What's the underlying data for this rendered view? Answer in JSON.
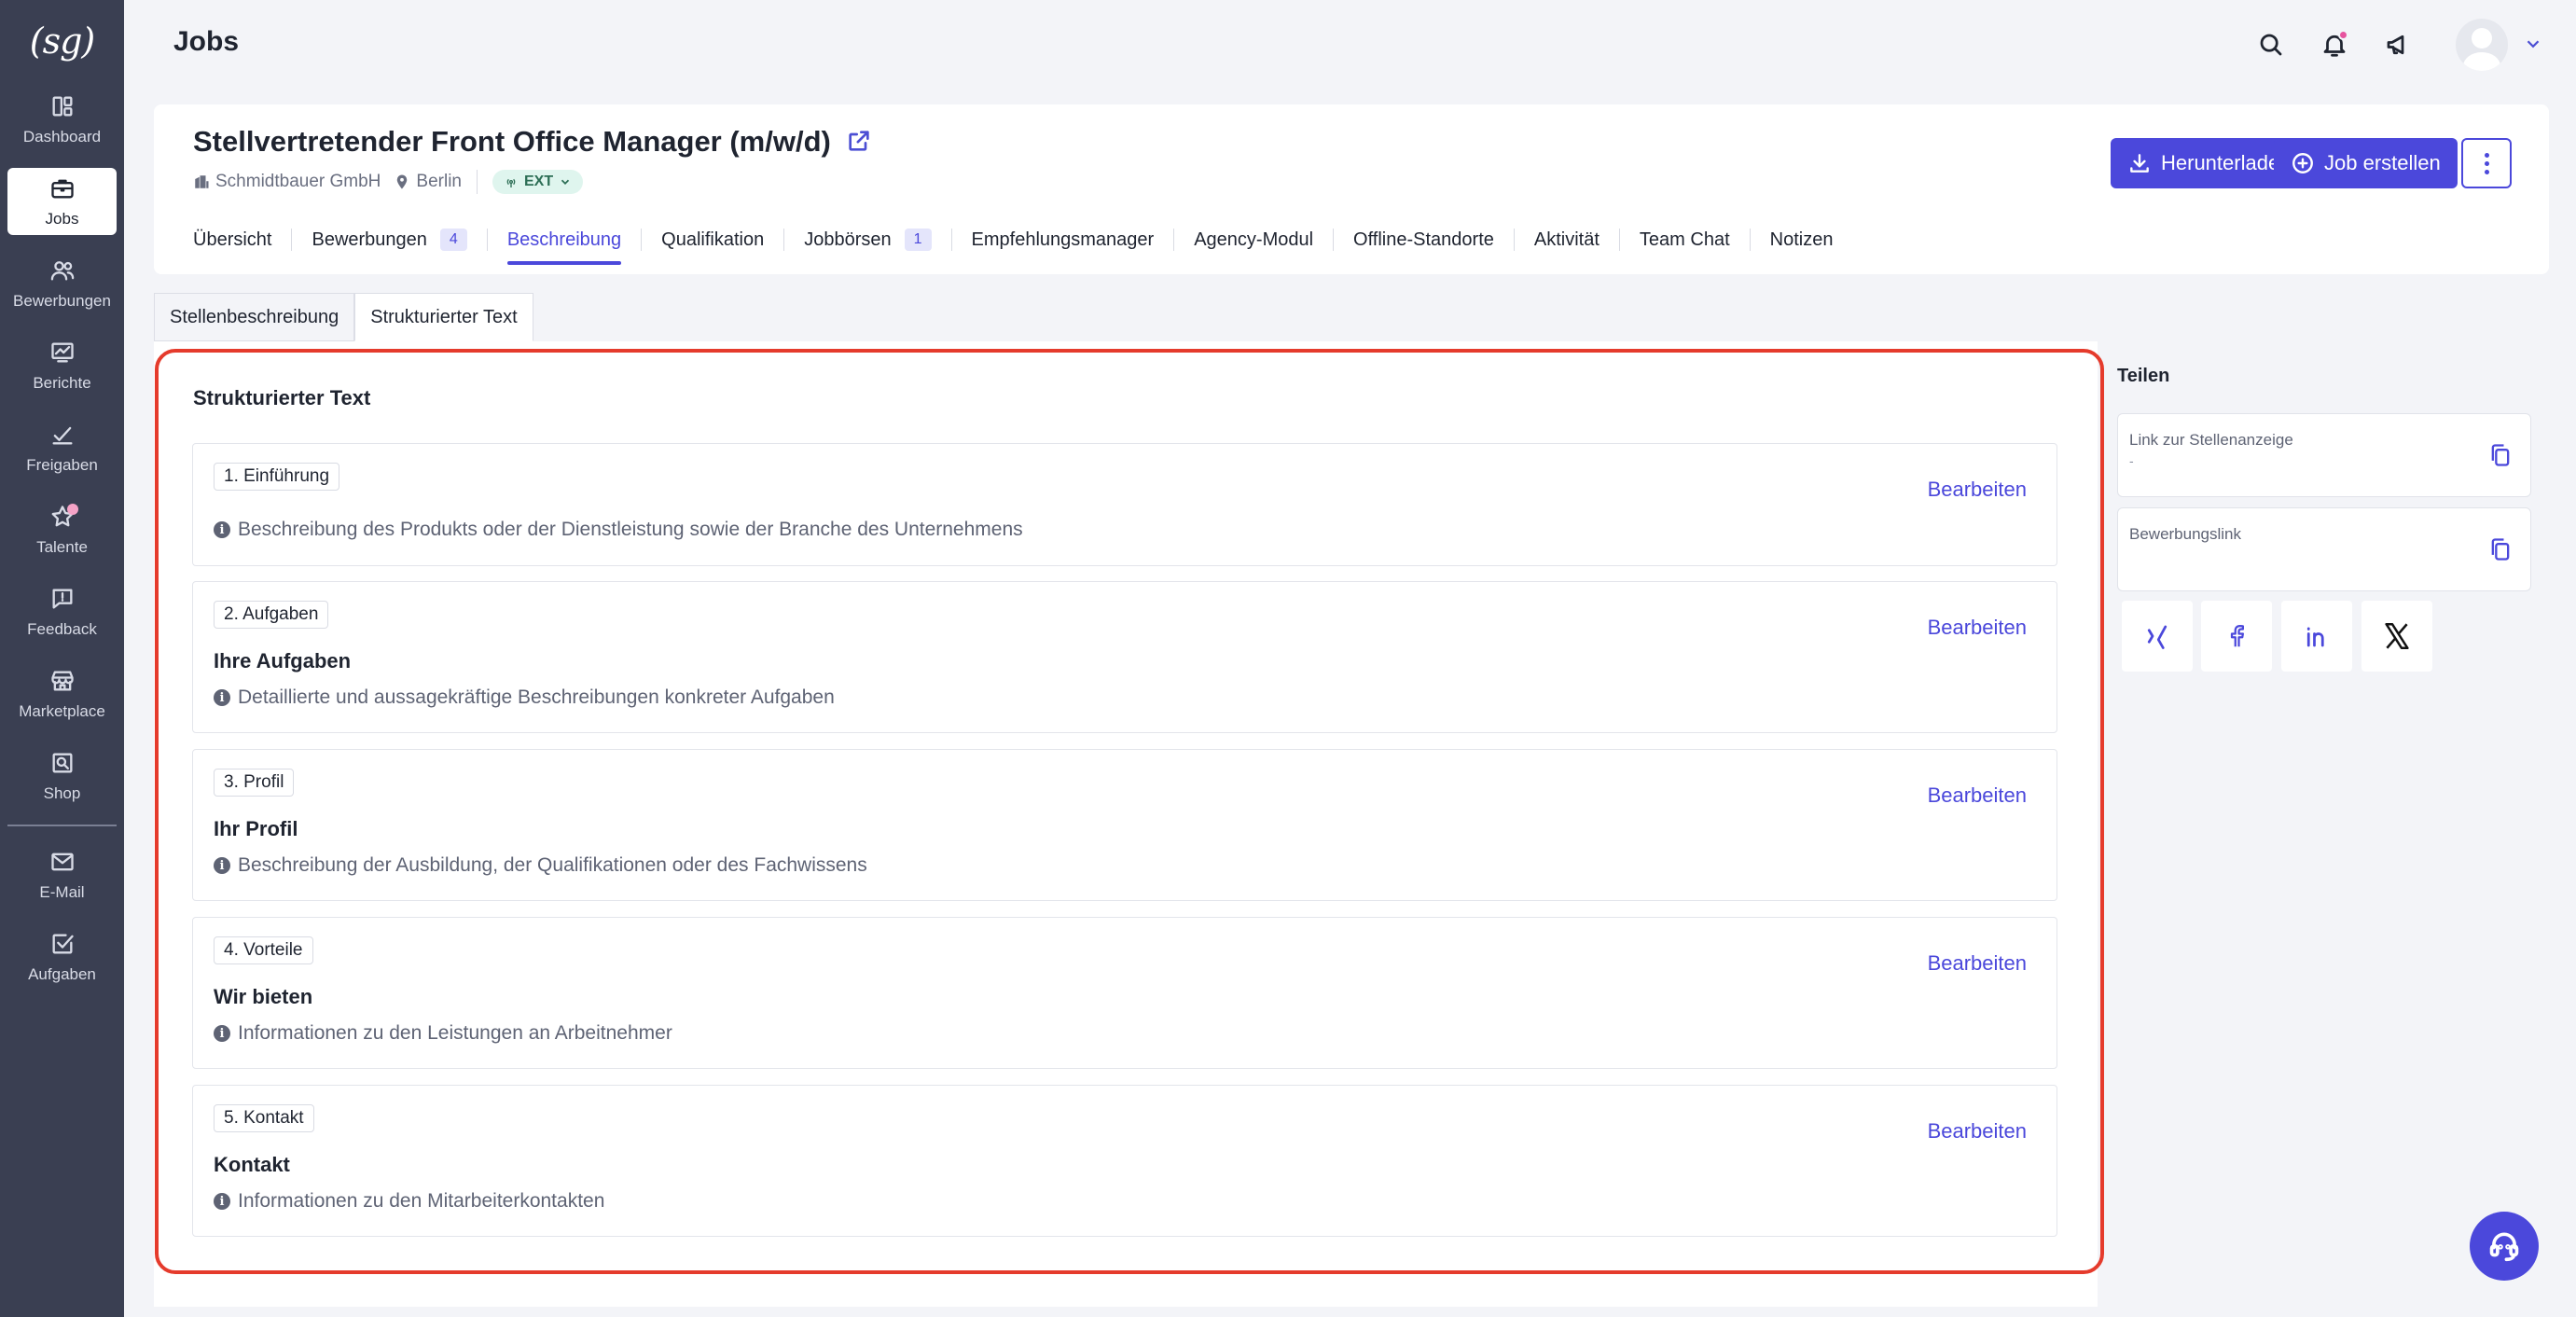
{
  "app": {
    "logo_text": "(sg)",
    "page_title": "Jobs"
  },
  "sidebar": {
    "items": [
      {
        "label": "Dashboard",
        "icon": "dashboard-icon"
      },
      {
        "label": "Jobs",
        "icon": "briefcase-icon",
        "active": true
      },
      {
        "label": "Bewerbungen",
        "icon": "users-icon"
      },
      {
        "label": "Berichte",
        "icon": "chart-icon"
      },
      {
        "label": "Freigaben",
        "icon": "approval-icon"
      },
      {
        "label": "Talente",
        "icon": "star-icon",
        "badge": true
      },
      {
        "label": "Feedback",
        "icon": "feedback-icon"
      },
      {
        "label": "Marketplace",
        "icon": "store-icon"
      },
      {
        "label": "Shop",
        "icon": "shop-icon"
      },
      {
        "label": "E-Mail",
        "icon": "mail-icon"
      },
      {
        "label": "Aufgaben",
        "icon": "tasks-icon"
      }
    ]
  },
  "topbar": {
    "icons": [
      "search-icon",
      "bell-icon",
      "megaphone-icon"
    ]
  },
  "job": {
    "title": "Stellvertretender Front Office Manager (m/w/d)",
    "company": "Schmidtbauer GmbH",
    "location": "Berlin",
    "badge": "EXT",
    "download_label": "Herunterladen",
    "create_label": "Job erstellen"
  },
  "tabs": [
    {
      "label": "Übersicht"
    },
    {
      "label": "Bewerbungen",
      "count": "4"
    },
    {
      "label": "Beschreibung",
      "active": true
    },
    {
      "label": "Qualifikation"
    },
    {
      "label": "Jobbörsen",
      "count": "1"
    },
    {
      "label": "Empfehlungsmanager"
    },
    {
      "label": "Agency-Modul"
    },
    {
      "label": "Offline-Standorte"
    },
    {
      "label": "Aktivität"
    },
    {
      "label": "Team Chat"
    },
    {
      "label": "Notizen"
    }
  ],
  "subtabs": {
    "first": "Stellenbeschreibung",
    "second": "Strukturierter Text"
  },
  "panel": {
    "title": "Strukturierter Text",
    "edit_label": "Bearbeiten",
    "sections": [
      {
        "tag": "1. Einführung",
        "heading": "",
        "hint": "Beschreibung des Produkts oder der Dienstleistung sowie der Branche des Unternehmens"
      },
      {
        "tag": "2. Aufgaben",
        "heading": "Ihre Aufgaben",
        "hint": "Detaillierte und aussagekräftige Beschreibungen konkreter Aufgaben"
      },
      {
        "tag": "3. Profil",
        "heading": "Ihr Profil",
        "hint": "Beschreibung der Ausbildung, der Qualifikationen oder des Fachwissens"
      },
      {
        "tag": "4. Vorteile",
        "heading": "Wir bieten",
        "hint": "Informationen zu den Leistungen an Arbeitnehmer"
      },
      {
        "tag": "5. Kontakt",
        "heading": "Kontakt",
        "hint": "Informationen zu den Mitarbeiterkontakten"
      }
    ]
  },
  "share": {
    "title": "Teilen",
    "link_label": "Link zur Stellenanzeige",
    "link_value": "-",
    "apply_label": "Bewerbungslink",
    "socials": [
      "xing-icon",
      "facebook-icon",
      "linkedin-icon",
      "x-icon"
    ]
  },
  "colors": {
    "accent": "#4b48db",
    "sidebar": "#3a3f52",
    "highlight": "#e53b2c"
  }
}
